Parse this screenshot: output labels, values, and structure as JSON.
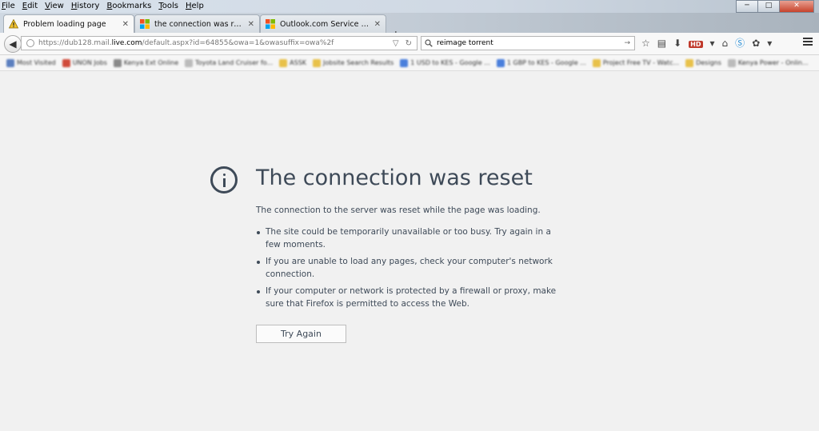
{
  "menubar": [
    "File",
    "Edit",
    "View",
    "History",
    "Bookmarks",
    "Tools",
    "Help"
  ],
  "window_controls": {
    "minimize": "─",
    "maximize": "□",
    "close": "✕"
  },
  "tabs": [
    {
      "label": "Problem loading page",
      "icon": "warning-icon"
    },
    {
      "label": "the connection was reset e...",
      "icon": "windows-logo-icon"
    },
    {
      "label": "Outlook.com Service Statu...",
      "icon": "windows-logo-icon"
    }
  ],
  "new_tab_label": "+",
  "nav": {
    "url_prefix": "https://dub128.mail.",
    "url_domain": "live.com",
    "url_suffix": "/default.aspx?id=64855&owa=1&owasuffix=owa%2f",
    "search_value": "reimage torrent"
  },
  "bookmarks": [
    {
      "label": "Most Visited",
      "color": "#5b7fbf"
    },
    {
      "label": "UNON Jobs",
      "color": "#d04a3a"
    },
    {
      "label": "Kenya Ext Online",
      "color": "#8a8a8a"
    },
    {
      "label": "Toyota Land Cruiser fo...",
      "color": "#bbbbbb"
    },
    {
      "label": "ASSK",
      "color": "#e8c14a"
    },
    {
      "label": "Jobsite Search Results",
      "color": "#e8c14a"
    },
    {
      "label": "1 USD to KES - Google ...",
      "color": "#4a7fdc"
    },
    {
      "label": "1 GBP to KES - Google ...",
      "color": "#4a7fdc"
    },
    {
      "label": "Project Free TV - Watc...",
      "color": "#e8c14a"
    },
    {
      "label": "Designs",
      "color": "#e8c14a"
    },
    {
      "label": "Kenya Power - Onlin...",
      "color": "#bbbbbb"
    }
  ],
  "error": {
    "title": "The connection was reset",
    "description": "The connection to the server was reset while the page was loading.",
    "items": [
      "The site could be temporarily unavailable or too busy. Try again in a few moments.",
      "If you are unable to load any pages, check your computer's network connection.",
      "If your computer or network is protected by a firewall or proxy, make sure that Firefox is permitted to access the Web."
    ],
    "button_label": "Try Again"
  }
}
